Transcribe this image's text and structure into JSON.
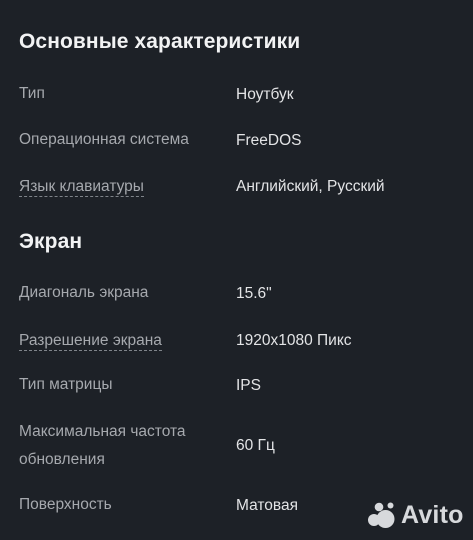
{
  "sections": [
    {
      "title": "Основные характеристики",
      "rows": [
        {
          "label": "Тип",
          "value": "Ноутбук"
        },
        {
          "label": "Операционная система",
          "value": "FreeDOS"
        },
        {
          "label": "Язык клавиатуры",
          "value": "Английский, Русский"
        }
      ]
    },
    {
      "title": "Экран",
      "rows": [
        {
          "label": "Диагональ экрана",
          "value": "15.6\""
        },
        {
          "label": "Разрешение экрана",
          "value": "1920x1080 Пикс"
        },
        {
          "label": "Тип матрицы",
          "value": "IPS"
        },
        {
          "label": "Максимальная частота",
          "label_line2": "обновления",
          "value": "60 Гц"
        },
        {
          "label": "Поверхность",
          "value": "Матовая"
        }
      ]
    }
  ],
  "watermark": {
    "text": "Avito",
    "icon": "avito-logo-icon"
  },
  "colors": {
    "background": "#1d2127",
    "label": "#a6a9ae",
    "value": "#e3e4e6",
    "title": "#f2f3f4"
  }
}
